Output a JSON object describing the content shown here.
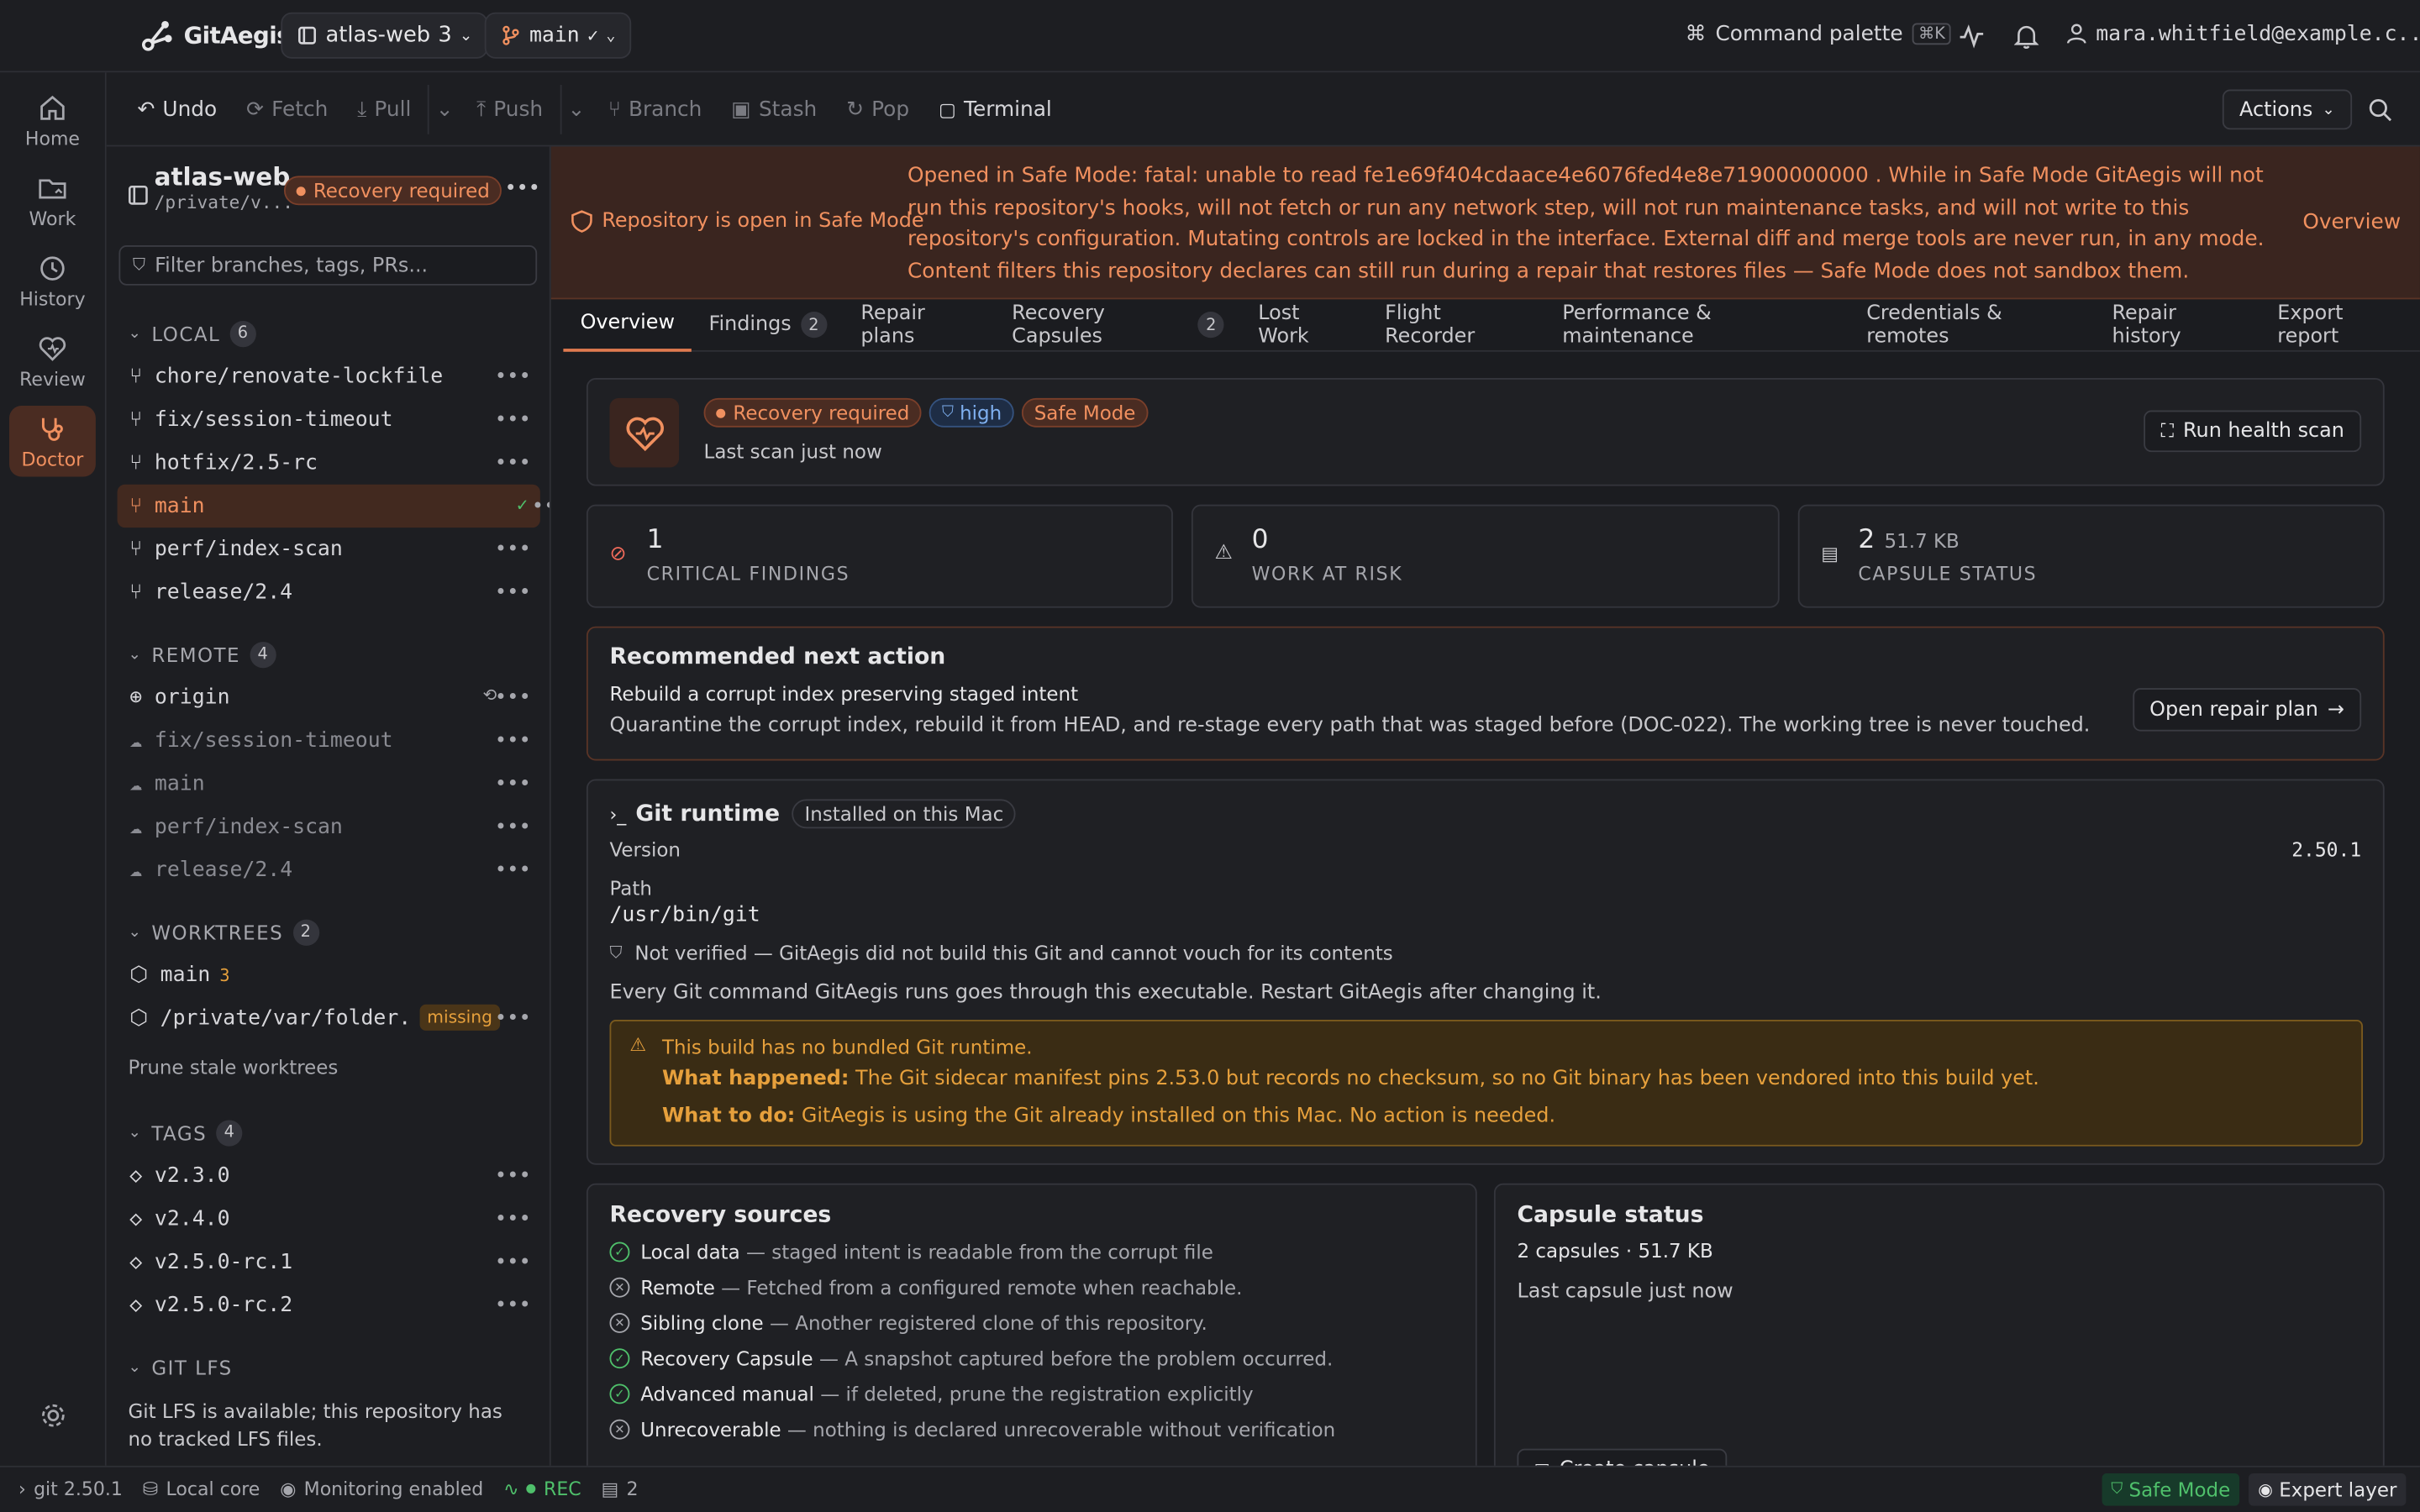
{
  "topbar": {
    "brand": "GitAegis",
    "repo_name": "atlas-web",
    "repo_count": "3",
    "branch": "main",
    "command_palette": "Command palette",
    "command_shortcut": "⌘K",
    "user_email": "mara.whitfield@example.c..."
  },
  "rail": {
    "items": [
      "Home",
      "Work",
      "History",
      "Review",
      "Doctor"
    ],
    "active": "Doctor"
  },
  "toolbar": {
    "undo": "Undo",
    "fetch": "Fetch",
    "pull": "Pull",
    "push": "Push",
    "branch": "Branch",
    "stash": "Stash",
    "pop": "Pop",
    "terminal": "Terminal",
    "actions": "Actions"
  },
  "sidebar": {
    "repo_name": "atlas-web",
    "repo_path": "/private/v...",
    "status_badge": "Recovery required",
    "filter_placeholder": "Filter branches, tags, PRs...",
    "local": {
      "title": "LOCAL",
      "count": "6",
      "items": [
        "chore/renovate-lockfile",
        "fix/session-timeout",
        "hotfix/2.5-rc",
        "main",
        "perf/index-scan",
        "release/2.4"
      ]
    },
    "remote": {
      "title": "REMOTE",
      "count": "4",
      "origin": "origin",
      "items": [
        "fix/session-timeout",
        "main",
        "perf/index-scan",
        "release/2.4"
      ]
    },
    "worktrees": {
      "title": "WORKTREES",
      "count": "2",
      "main_label": "main",
      "main_count": "3",
      "other_path": "/private/var/folder...",
      "missing_badge": "missing",
      "prune": "Prune stale worktrees"
    },
    "tags": {
      "title": "TAGS",
      "count": "4",
      "items": [
        "v2.3.0",
        "v2.4.0",
        "v2.5.0-rc.1",
        "v2.5.0-rc.2"
      ]
    },
    "lfs": {
      "title": "GIT LFS",
      "text": "Git LFS is available; this repository has no tracked LFS files."
    }
  },
  "banner": {
    "label": "Repository is open in Safe Mode",
    "message": "Opened in Safe Mode: fatal: unable to read fe1e69f404cdaace4e6076fed4e8e71900000000 . While in Safe Mode GitAegis will not run this repository's hooks, will not fetch or run any network step, will not run maintenance tasks, and will not write to this repository's configuration. Mutating controls are locked in the interface. External diff and merge tools are never run, in any mode. Content filters this repository declares can still run during a repair that restores files — Safe Mode does not sandbox them.",
    "link": "Overview"
  },
  "tabs": [
    {
      "label": "Overview",
      "count": ""
    },
    {
      "label": "Findings",
      "count": "2"
    },
    {
      "label": "Repair plans",
      "count": ""
    },
    {
      "label": "Recovery Capsules",
      "count": "2"
    },
    {
      "label": "Lost Work",
      "count": ""
    },
    {
      "label": "Flight Recorder",
      "count": ""
    },
    {
      "label": "Performance & maintenance",
      "count": ""
    },
    {
      "label": "Credentials & remotes",
      "count": ""
    },
    {
      "label": "Repair history",
      "count": ""
    },
    {
      "label": "Export report",
      "count": ""
    }
  ],
  "health": {
    "badge_recovery": "Recovery required",
    "badge_severity": "high",
    "badge_safe": "Safe Mode",
    "last_scan": "Last scan just now",
    "scan_button": "Run health scan"
  },
  "stats": [
    {
      "value": "1",
      "unit": "",
      "label": "CRITICAL FINDINGS"
    },
    {
      "value": "0",
      "unit": "",
      "label": "WORK AT RISK"
    },
    {
      "value": "2",
      "unit": "51.7 KB",
      "label": "CAPSULE STATUS"
    }
  ],
  "recommend": {
    "title": "Recommended next action",
    "subtitle": "Rebuild a corrupt index preserving staged intent",
    "description": "Quarantine the corrupt index, rebuild it from HEAD, and re-stage every path that was staged before (DOC-022). The working tree is never touched.",
    "button": "Open repair plan"
  },
  "git_runtime": {
    "title": "Git runtime",
    "badge": "Installed on this Mac",
    "version_label": "Version",
    "version": "2.50.1",
    "path_label": "Path",
    "path": "/usr/bin/git",
    "verify": "Not verified — GitAegis did not build this Git and cannot vouch for its contents",
    "note": "Every Git command GitAegis runs goes through this executable. Restart GitAegis after changing it.",
    "warning_title": "This build has no bundled Git runtime.",
    "what_happened_label": "What happened:",
    "what_happened": "The Git sidecar manifest pins 2.53.0 but records no checksum, so no Git binary has been vendored into this build yet.",
    "what_to_do_label": "What to do:",
    "what_to_do": "GitAegis is using the Git already installed on this Mac. No action is needed."
  },
  "recovery_sources": {
    "title": "Recovery sources",
    "items": [
      {
        "name": "Local data",
        "desc": " — staged intent is readable from the corrupt file",
        "ok": true
      },
      {
        "name": "Remote",
        "desc": " — Fetched from a configured remote when reachable.",
        "ok": false
      },
      {
        "name": "Sibling clone",
        "desc": " — Another registered clone of this repository.",
        "ok": false
      },
      {
        "name": "Recovery Capsule",
        "desc": " — A snapshot captured before the problem occurred.",
        "ok": true
      },
      {
        "name": "Advanced manual",
        "desc": " — if deleted, prune the registration explicitly",
        "ok": true
      },
      {
        "name": "Unrecoverable",
        "desc": " — nothing is declared unrecoverable without verification",
        "ok": false
      }
    ]
  },
  "capsule": {
    "title": "Capsule status",
    "summary": "2 capsules · 51.7 KB",
    "last": "Last capsule just now",
    "button": "Create capsule"
  },
  "statusbar": {
    "git": "git 2.50.1",
    "local": "Local core",
    "monitoring": "Monitoring enabled",
    "rec": "REC",
    "capsules": "2",
    "safe_mode": "Safe Mode",
    "expert": "Expert layer"
  },
  "colors": {
    "accent": "#e07a4f",
    "safe_banner": "#3a251f",
    "warning": "#e6a03c",
    "success": "#4fc06b"
  }
}
